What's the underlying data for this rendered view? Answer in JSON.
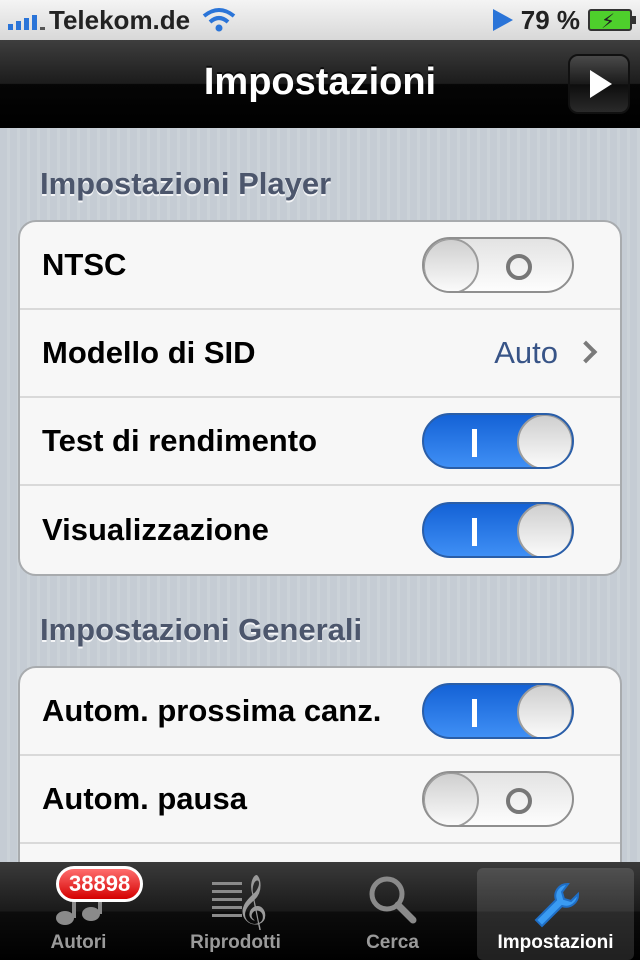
{
  "status_bar": {
    "carrier": "Telekom.de",
    "battery": "79 %"
  },
  "nav": {
    "title": "Impostazioni"
  },
  "sections": [
    {
      "header": "Impostazioni Player",
      "rows": [
        {
          "label": "NTSC",
          "type": "switch",
          "on": false
        },
        {
          "label": "Modello di SID",
          "type": "value",
          "value": "Auto"
        },
        {
          "label": "Test di rendimento",
          "type": "switch",
          "on": true
        },
        {
          "label": "Visualizzazione",
          "type": "switch",
          "on": true
        }
      ]
    },
    {
      "header": "Impostazioni Generali",
      "rows": [
        {
          "label": "Autom. prossima canz.",
          "type": "switch",
          "on": true
        },
        {
          "label": "Autom. pausa",
          "type": "switch",
          "on": false
        }
      ]
    }
  ],
  "tab_bar": {
    "tabs": [
      {
        "label": "Autori",
        "icon": "music-notes-icon",
        "badge": "38898"
      },
      {
        "label": "Riprodotti",
        "icon": "treble-clef-icon"
      },
      {
        "label": "Cerca",
        "icon": "magnifier-icon"
      },
      {
        "label": "Impostazioni",
        "icon": "wrench-icon",
        "active": true
      }
    ]
  }
}
